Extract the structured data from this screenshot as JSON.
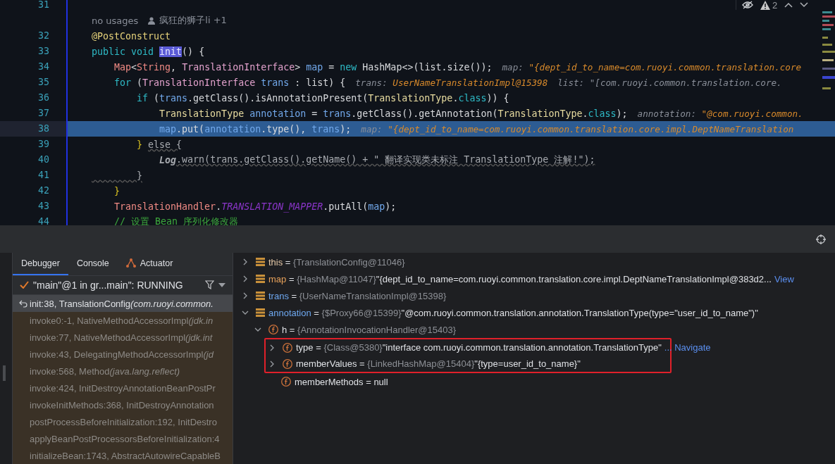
{
  "editor": {
    "lines": [
      {
        "kind": "code",
        "number": "31",
        "current": false
      },
      {
        "kind": "hint",
        "usages": "no usages",
        "authors": "疯狂的狮子li +1"
      },
      {
        "kind": "code",
        "number": "32",
        "current": false,
        "tokens": [
          {
            "text": "@PostConstruct",
            "kind": "annot"
          }
        ]
      },
      {
        "kind": "code",
        "number": "33",
        "current": false,
        "tokens": [
          {
            "text": "public void ",
            "kind": "kw"
          },
          {
            "text": "init",
            "kind": "hl"
          },
          {
            "text": "() {",
            "kind": "plain"
          }
        ]
      },
      {
        "kind": "code",
        "number": "34",
        "current": false,
        "tokens": [
          {
            "text": "    Map",
            "kind": "type"
          },
          {
            "text": "<",
            "kind": "plain"
          },
          {
            "text": "String",
            "kind": "type"
          },
          {
            "text": ", ",
            "kind": "plain"
          },
          {
            "text": "TranslationInterface",
            "kind": "iface"
          },
          {
            "text": "> ",
            "kind": "plain"
          },
          {
            "text": "map",
            "kind": "var"
          },
          {
            "text": " = ",
            "kind": "plain"
          },
          {
            "text": "new ",
            "kind": "kw"
          },
          {
            "text": "HashMap<>(list.size());",
            "kind": "plain"
          },
          {
            "text": "map: ",
            "kind": "inlay"
          },
          {
            "text": "\"{dept_id_to_name=com.ruoyi.common.translation.core",
            "kind": "inlayval"
          }
        ]
      },
      {
        "kind": "code",
        "number": "35",
        "current": false,
        "tokens": [
          {
            "text": "    for ",
            "kind": "kw"
          },
          {
            "text": "(",
            "kind": "plain"
          },
          {
            "text": "TranslationInterface ",
            "kind": "iface"
          },
          {
            "text": "trans",
            "kind": "var"
          },
          {
            "text": " : list) {",
            "kind": "plain"
          },
          {
            "text": "trans: ",
            "kind": "inlay"
          },
          {
            "text": "UserNameTranslationImpl@15398",
            "kind": "inlayval"
          },
          {
            "text": "list: \"[com.ruoyi.common.translation.core.",
            "kind": "inlay2"
          }
        ]
      },
      {
        "kind": "code",
        "number": "36",
        "current": false,
        "tokens": [
          {
            "text": "        if ",
            "kind": "kw"
          },
          {
            "text": "(",
            "kind": "plain"
          },
          {
            "text": "trans",
            "kind": "var"
          },
          {
            "text": ".getClass().isAnnotationPresent(",
            "kind": "plain"
          },
          {
            "text": "TranslationType",
            "kind": "ttype"
          },
          {
            "text": ".",
            "kind": "plain"
          },
          {
            "text": "class",
            "kind": "kw"
          },
          {
            "text": ")) {",
            "kind": "plain"
          }
        ]
      },
      {
        "kind": "code",
        "number": "37",
        "current": false,
        "tokens": [
          {
            "text": "            TranslationType ",
            "kind": "ttype"
          },
          {
            "text": "annotation",
            "kind": "var"
          },
          {
            "text": " = ",
            "kind": "plain"
          },
          {
            "text": "trans",
            "kind": "var"
          },
          {
            "text": ".getClass().getAnnotation(",
            "kind": "plain"
          },
          {
            "text": "TranslationType",
            "kind": "ttype"
          },
          {
            "text": ".",
            "kind": "plain"
          },
          {
            "text": "class",
            "kind": "kw"
          },
          {
            "text": ");",
            "kind": "plain"
          },
          {
            "text": "annotation: ",
            "kind": "inlay"
          },
          {
            "text": "\"@com.ruoyi.common.",
            "kind": "inlayval"
          }
        ]
      },
      {
        "kind": "code",
        "number": "38",
        "current": true,
        "tokens": [
          {
            "text": "            map",
            "kind": "var"
          },
          {
            "text": ".put(",
            "kind": "plain"
          },
          {
            "text": "annotation",
            "kind": "var"
          },
          {
            "text": ".type(), ",
            "kind": "plain"
          },
          {
            "text": "trans",
            "kind": "var"
          },
          {
            "text": ");",
            "kind": "plain"
          },
          {
            "text": "map: ",
            "kind": "inlay"
          },
          {
            "text": "\"{dept_id_to_name=com.ruoyi.common.translation.core.impl.DeptNameTranslation",
            "kind": "inlayval"
          }
        ]
      },
      {
        "kind": "code",
        "number": "39",
        "current": false,
        "tokens": [
          {
            "text": "        } ",
            "kind": "brace"
          },
          {
            "text": "else {",
            "kind": "dim"
          }
        ]
      },
      {
        "kind": "code",
        "number": "40",
        "current": false,
        "tokens": [
          {
            "text": "            Log",
            "kind": "dimital"
          },
          {
            "text": ".warn(trans.getClass().getName() + \" 翻译实现类未标注 TranslationType 注解!\");",
            "kind": "dim"
          }
        ]
      },
      {
        "kind": "code",
        "number": "41",
        "current": false,
        "tokens": [
          {
            "text": "        }",
            "kind": "dim"
          }
        ]
      },
      {
        "kind": "code",
        "number": "42",
        "current": false,
        "tokens": [
          {
            "text": "    }",
            "kind": "brace"
          }
        ]
      },
      {
        "kind": "code",
        "number": "43",
        "current": false,
        "tokens": [
          {
            "text": "    TranslationHandler",
            "kind": "type"
          },
          {
            "text": ".",
            "kind": "plain"
          },
          {
            "text": "TRANSLATION_MAPPER",
            "kind": "const"
          },
          {
            "text": ".putAll(",
            "kind": "plain"
          },
          {
            "text": "map",
            "kind": "var"
          },
          {
            "text": ");",
            "kind": "plain"
          }
        ]
      },
      {
        "kind": "code",
        "number": "44",
        "current": false,
        "tokens": [
          {
            "text": "    // 设置 Bean 序列化修改器",
            "kind": "comment"
          }
        ]
      }
    ],
    "warnings": "2"
  },
  "tabs": [
    {
      "label": "Debugger",
      "selected": true
    },
    {
      "label": "Console",
      "selected": false
    },
    {
      "label": "Actuator",
      "selected": false
    }
  ],
  "thread": {
    "label": "\"main\"@1 in gr...main\": RUNNING"
  },
  "frames": [
    {
      "method": "init:38, TranslationConfig",
      "package": "(com.ruoyi.common.",
      "selected": true
    },
    {
      "method": "invoke0:-1, NativeMethodAccessorImpl",
      "package": "(jdk.in",
      "selected": false
    },
    {
      "method": "invoke:77, NativeMethodAccessorImpl",
      "package": "(jdk.int",
      "selected": false
    },
    {
      "method": "invoke:43, DelegatingMethodAccessorImpl",
      "package": "(jd",
      "selected": false
    },
    {
      "method": "invoke:568, Method",
      "package": "(java.lang.reflect)",
      "selected": false
    },
    {
      "method": "invoke:424, InitDestroyAnnotationBeanPostPr",
      "selected": false
    },
    {
      "method": "invokeInitMethods:368, InitDestroyAnnotation",
      "selected": false
    },
    {
      "method": "postProcessBeforeInitialization:192, InitDestro",
      "selected": false
    },
    {
      "method": "applyBeanPostProcessorsBeforeInitialization:4",
      "selected": false
    },
    {
      "method": "initializeBean:1743, AbstractAutowireCapableB",
      "selected": false
    }
  ],
  "variables": [
    {
      "kind": "local",
      "name": "this",
      "color": "#e6c9a8",
      "operator": "=",
      "type": "{TranslationConfig@11046}",
      "expanded": false,
      "boxed": false
    },
    {
      "kind": "local",
      "name": "map",
      "color": "#e8a25a",
      "operator": "=",
      "type": "{HashMap@11047}",
      "value": "\"{dept_id_to_name=com.ruoyi.common.translation.core.impl.DeptNameTranslationImpl@383d2...",
      "link": "View",
      "expanded": false,
      "boxed": false
    },
    {
      "kind": "local",
      "name": "trans",
      "color": "#6ea8f0",
      "operator": "=",
      "type": "{UserNameTranslationImpl@15398}",
      "expanded": false,
      "boxed": false
    },
    {
      "kind": "local",
      "name": "annotation",
      "color": "#6ea8f0",
      "operator": "=",
      "type": "{$Proxy66@15399}",
      "value": "\"@com.ruoyi.common.translation.annotation.TranslationType(type=\"user_id_to_name\")\"",
      "expanded": true,
      "boxed": false,
      "children": [
        {
          "kind": "field",
          "name": "h",
          "color": "#dfe1e5",
          "operator": "=",
          "type": "{AnnotationInvocationHandler@15403}",
          "expanded": true,
          "boxed": false,
          "children": [
            {
              "kind": "field",
              "name": "type",
              "color": "#dfe1e5",
              "operator": "=",
              "type": "{Class@5380}",
              "value": "\"interface com.ruoyi.common.translation.annotation.TranslationType\"",
              "link": "... Navigate",
              "expanded": false,
              "boxed": true
            },
            {
              "kind": "field",
              "name": "memberValues",
              "color": "#dfe1e5",
              "operator": "=",
              "type": "{LinkedHashMap@15404}",
              "value": "\"{type=user_id_to_name}\"",
              "expanded": false,
              "boxed": true
            },
            {
              "kind": "field",
              "name": "memberMethods",
              "color": "#dfe1e5",
              "operator": "=",
              "value": "null",
              "boxed": false
            }
          ]
        }
      ]
    }
  ]
}
